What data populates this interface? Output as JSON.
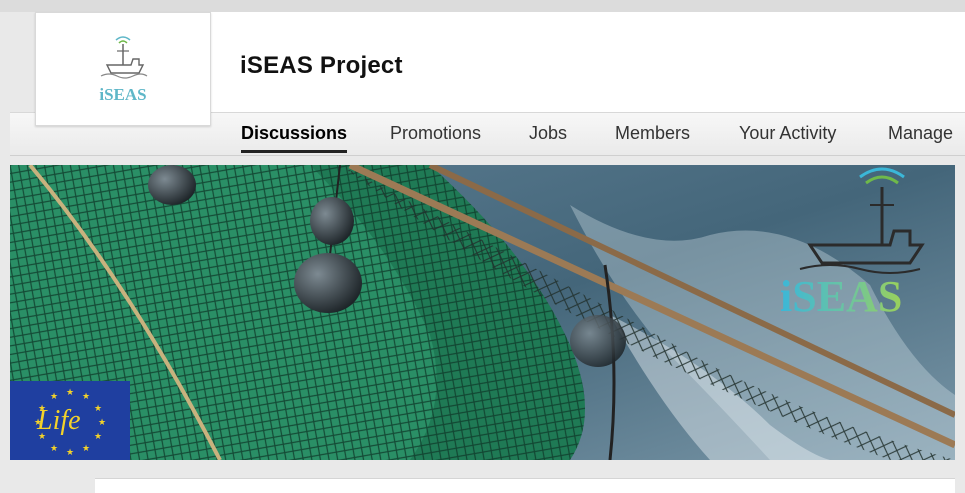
{
  "group": {
    "title": "iSEAS Project",
    "logo_text": "iSEAS"
  },
  "nav": {
    "tabs": [
      {
        "label": "Discussions",
        "active": true
      },
      {
        "label": "Promotions",
        "active": false
      },
      {
        "label": "Jobs",
        "active": false
      },
      {
        "label": "Members",
        "active": false
      },
      {
        "label": "Your Activity",
        "active": false
      },
      {
        "label": "Manage",
        "active": false
      }
    ]
  },
  "banner": {
    "logo_text": "iSEAS",
    "badge_text": "Life"
  },
  "colors": {
    "accent_teal": "#3bb7d8",
    "accent_green": "#9ad05a",
    "eu_blue": "#1f3fa0",
    "eu_gold": "#f3d22a",
    "net_green": "#1f7a55"
  }
}
